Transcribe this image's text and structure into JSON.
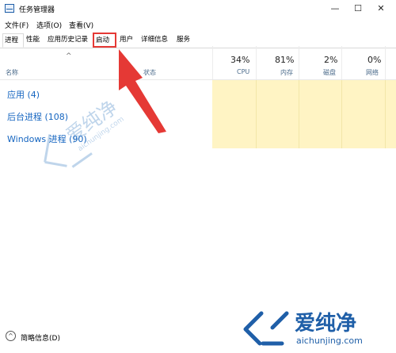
{
  "window": {
    "title": "任务管理器",
    "minimize": "—",
    "maximize": "☐",
    "close": "✕"
  },
  "menu": {
    "file": "文件(F)",
    "options": "选项(O)",
    "view": "查看(V)"
  },
  "tabs": [
    {
      "label": "进程"
    },
    {
      "label": "性能"
    },
    {
      "label": "应用历史记录"
    },
    {
      "label": "启动"
    },
    {
      "label": "用户"
    },
    {
      "label": "详细信息"
    },
    {
      "label": "服务"
    }
  ],
  "columns": {
    "name": "名称",
    "status": "状态",
    "cpu": {
      "pct": "34%",
      "label": "CPU"
    },
    "memory": {
      "pct": "81%",
      "label": "内存"
    },
    "disk": {
      "pct": "2%",
      "label": "磁盘"
    },
    "network": {
      "pct": "0%",
      "label": "网络"
    }
  },
  "groups": [
    {
      "label": "应用 (4)"
    },
    {
      "label": "后台进程 (108)"
    },
    {
      "label": "Windows 进程 (90)"
    }
  ],
  "footer": {
    "label": "简略信息(D)"
  },
  "watermark": {
    "brand": "爱纯净",
    "url": "aichunjing.com"
  },
  "colors": {
    "accent": "#1565c0",
    "highlight": "#e53935",
    "heat": "#fff4c4"
  }
}
